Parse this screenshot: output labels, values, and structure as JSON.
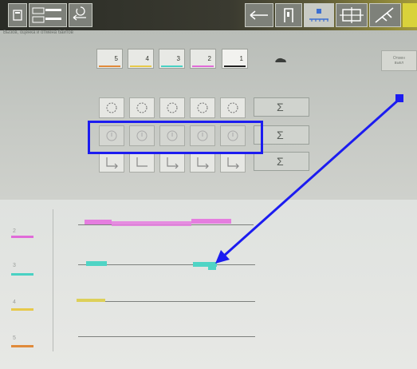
{
  "toolbar": {
    "left_buttons": [
      {
        "name": "screen-icon"
      },
      {
        "name": "list-toggle-icon"
      },
      {
        "name": "refresh-back-icon"
      }
    ],
    "right_buttons": [
      {
        "name": "arrow-left-icon"
      },
      {
        "name": "door-icon"
      },
      {
        "name": "stations-icon"
      },
      {
        "name": "rack-icon"
      },
      {
        "name": "tool-icon"
      }
    ]
  },
  "subtitle": "Вызов, оценка и отмена байтов",
  "groups": [
    {
      "label": "5",
      "color": "#e08a3a"
    },
    {
      "label": "4",
      "color": "#e7c94a"
    },
    {
      "label": "3",
      "color": "#49d1c3"
    },
    {
      "label": "2",
      "color": "#e06bd8"
    },
    {
      "label": "1",
      "color": "#222222"
    }
  ],
  "right_button": {
    "line1": "Отмен",
    "line2": "выкл"
  },
  "sigma_symbol": "Σ",
  "rows": [
    {
      "label": "2",
      "color": "#e06bd8"
    },
    {
      "label": "3",
      "color": "#49d1c3"
    },
    {
      "label": "4",
      "color": "#e7c94a"
    },
    {
      "label": "5",
      "color": "#e08a3a"
    }
  ],
  "colors": {
    "annotation": "#1c1cf0"
  }
}
